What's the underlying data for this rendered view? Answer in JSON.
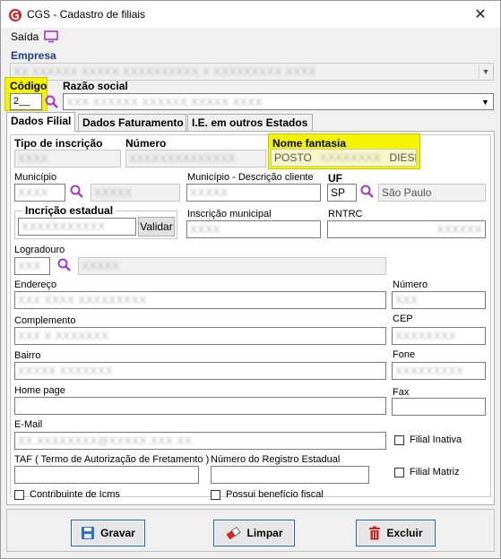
{
  "window": {
    "title": "CGS - Cadastro de filiais",
    "close_glyph": "✕"
  },
  "menu": {
    "saida": "Saída"
  },
  "empresa": {
    "label": "Empresa",
    "value": "XX XXXXXX XXXXX XXXXXXXXXX X XXXXXXXXX XXXX"
  },
  "codigo": {
    "label": "Código",
    "value": "2__"
  },
  "razao": {
    "label": "Razão social",
    "value": "XXX XXXXXX XXXXXX XXXXX XXXX"
  },
  "tabs": [
    {
      "label": "Dados Filial"
    },
    {
      "label": "Dados Faturamento"
    },
    {
      "label": "I.E. em outros Estados"
    }
  ],
  "form": {
    "tipo_inscricao": {
      "label": "Tipo de inscrição",
      "value": "XXXX"
    },
    "numero_cnpj": {
      "label": "Número",
      "value": "XXXXXXXXXXXXXX"
    },
    "nome_fantasia": {
      "label": "Nome fantasia",
      "prefix": "POSTO",
      "blurred": "XXXXXXXX",
      "suffix": "DIESEL"
    },
    "municipio": {
      "label": "Município",
      "code": "XXXX",
      "name": "XXXXX"
    },
    "municipio_desc": {
      "label": "Município - Descrição cliente",
      "value": "XXXXX"
    },
    "uf": {
      "label": "UF",
      "value": "SP",
      "name": "São Paulo"
    },
    "inscricao_estadual": {
      "label": "Incrição estadual",
      "value": "XXXXXXXXXXX",
      "validar": "Validar"
    },
    "inscricao_municipal": {
      "label": "Inscrição municipal",
      "value": "XXXX"
    },
    "rntrc": {
      "label": "RNTRC",
      "value": "XXXXXX"
    },
    "logradouro": {
      "label": "Logradouro",
      "code": "XXX",
      "name": "XXXXX"
    },
    "endereco": {
      "label": "Endereço",
      "value": "XXX XXXX XXXXXXXXX"
    },
    "numero": {
      "label": "Número",
      "value": "XXX"
    },
    "complemento": {
      "label": "Complemento",
      "value": "XXX X XXXXXXX"
    },
    "cep": {
      "label": "CEP",
      "value": "XXXXXXXX"
    },
    "bairro": {
      "label": "Bairro",
      "value": "XXXXX XXXXXXX"
    },
    "fone": {
      "label": "Fone",
      "value": "XXXXXXXXX"
    },
    "home_page": {
      "label": "Home page",
      "value": ""
    },
    "fax": {
      "label": "Fax",
      "value": ""
    },
    "email": {
      "label": "E-Mail",
      "value": "XX.XXXXXXXX@XXXXX.XXX.XX"
    },
    "filial_inativa": {
      "label": "Filial Inativa",
      "checked": false
    },
    "taf": {
      "label": "TAF ( Termo de Autorização de Fretamento )",
      "value": ""
    },
    "registro_estadual": {
      "label": "Número do Registro Estadual",
      "value": ""
    },
    "filial_matriz": {
      "label": "Filial Matriz",
      "checked": false
    },
    "contribuinte_icms": {
      "label": "Contribuinte de Icms",
      "checked": false
    },
    "beneficio_fiscal": {
      "label": "Possui benefício fiscal",
      "checked": false
    }
  },
  "buttons": {
    "gravar": "Gravar",
    "limpar": "Limpar",
    "excluir": "Excluir"
  },
  "colors": {
    "highlight": "#f4f400",
    "label_blue": "#1f3d8c",
    "magnifier": "#a637c9",
    "button_border": "#1f5fbf"
  },
  "icons": {
    "app": "cgs-logo-icon",
    "monitor": "monitor-icon",
    "search": "magnifier-icon",
    "save": "floppy-disk-icon",
    "clear": "eraser-icon",
    "delete": "trash-icon"
  }
}
